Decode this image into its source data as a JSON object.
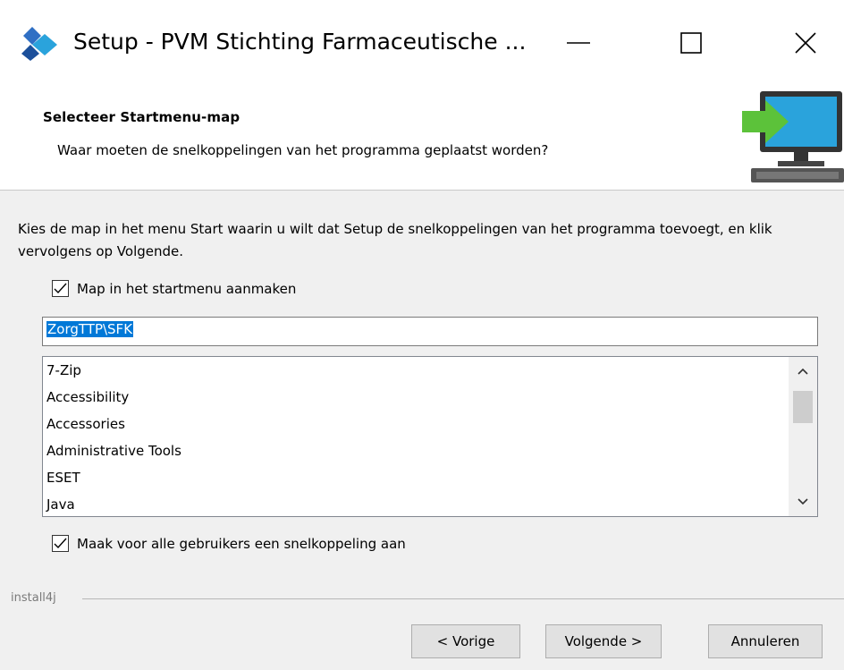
{
  "window": {
    "title": "Setup - PVM Stichting Farmaceutische ...",
    "minimize_icon": "minimize-icon",
    "maximize_icon": "maximize-icon",
    "close_icon": "close-icon"
  },
  "header": {
    "title": "Selecteer Startmenu-map",
    "subtitle": "Waar moeten de snelkoppelingen van het programma geplaatst worden?",
    "graphic_icon": "computer-install-arrow-icon"
  },
  "content": {
    "description": "Kies de map in het menu Start waarin u wilt dat Setup de snelkoppelingen van het programma toevoegt, en klik vervolgens op Volgende.",
    "create_folder_checkbox": {
      "label": "Map in het startmenu aanmaken",
      "checked": true
    },
    "folder_input": {
      "value": "ZorgTTP\\SFK"
    },
    "folder_list": [
      "7-Zip",
      "Accessibility",
      "Accessories",
      "Administrative Tools",
      "ESET",
      "Java"
    ],
    "all_users_checkbox": {
      "label": "Maak voor alle gebruikers een snelkoppeling aan",
      "checked": true
    }
  },
  "footer": {
    "brand": "install4j",
    "prev_label": "< Vorige",
    "next_label": "Volgende >",
    "cancel_label": "Annuleren"
  },
  "colors": {
    "selection": "#0078d7",
    "accent_green": "#5cc23a",
    "monitor_blue": "#2aa3dc"
  }
}
